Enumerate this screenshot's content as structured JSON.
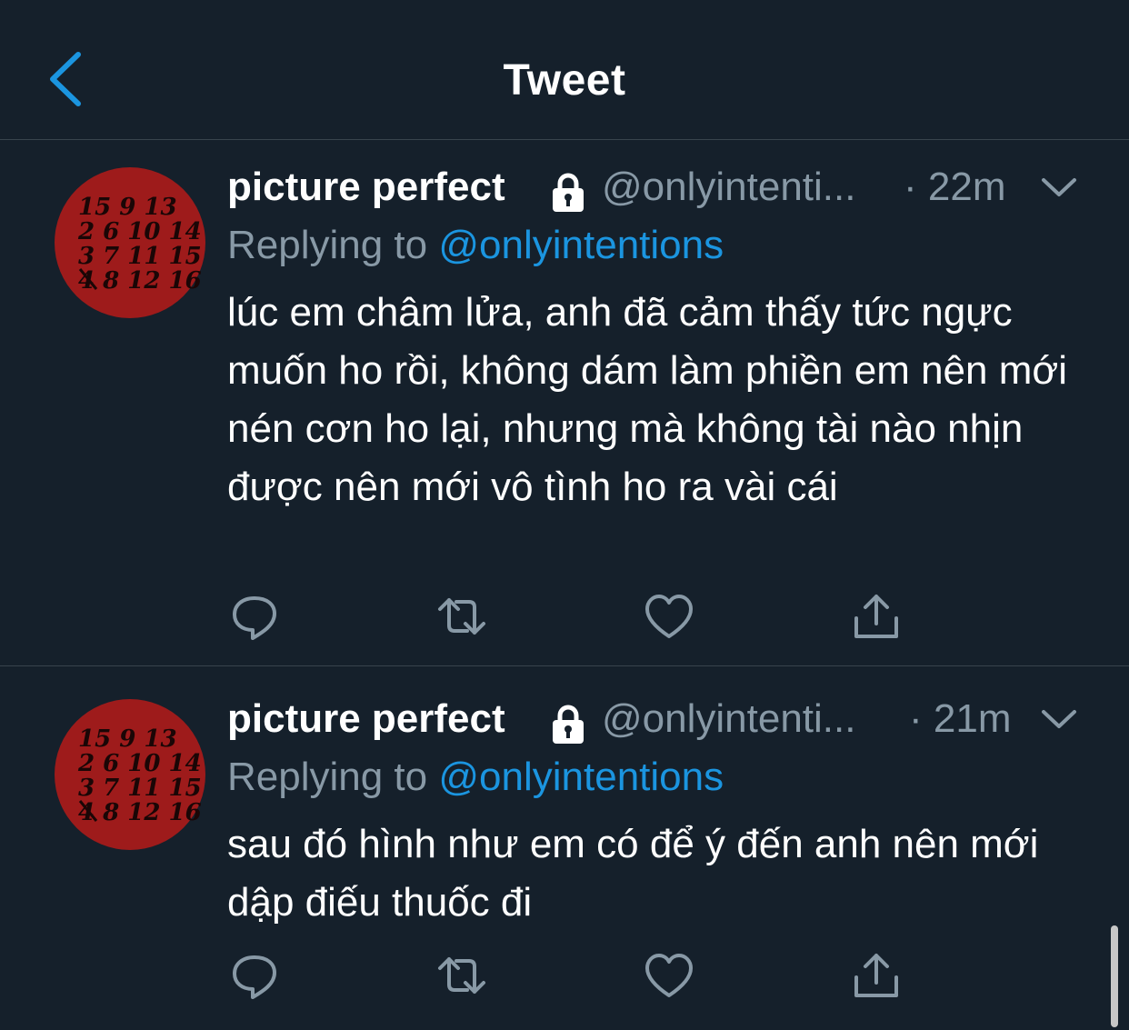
{
  "header": {
    "title": "Tweet",
    "back_icon": "chevron-left-icon"
  },
  "colors": {
    "background": "#15202b",
    "accent": "#1b95e0",
    "secondary_text": "#8899a6",
    "divider": "#38444d",
    "avatar_red": "#9e1b1b"
  },
  "avatar_text": [
    "15 9 13",
    "2 6 10 14",
    "3 7 11 15",
    "4 8 12 16"
  ],
  "tweets": [
    {
      "display_name": "picture perfect",
      "handle": "@onlyintenti...",
      "time": "· 22m",
      "reply_label": "Replying to",
      "reply_to": "@onlyintentions",
      "text": "lúc em châm lửa, anh đã cảm thấy tức ngực muốn ho rồi, không dám làm phiền em nên mới nén cơn ho lại, nhưng mà không tài nào nhịn được nên mới vô tình ho ra vài cái",
      "actions": [
        "reply-icon",
        "retweet-icon",
        "like-icon",
        "share-icon"
      ]
    },
    {
      "display_name": "picture perfect",
      "handle": "@onlyintenti...",
      "time": "· 21m",
      "reply_label": "Replying to",
      "reply_to": "@onlyintentions",
      "text": "sau đó hình như em có để ý đến anh nên mới dập điếu thuốc đi",
      "actions": [
        "reply-icon",
        "retweet-icon",
        "like-icon",
        "share-icon"
      ]
    }
  ]
}
